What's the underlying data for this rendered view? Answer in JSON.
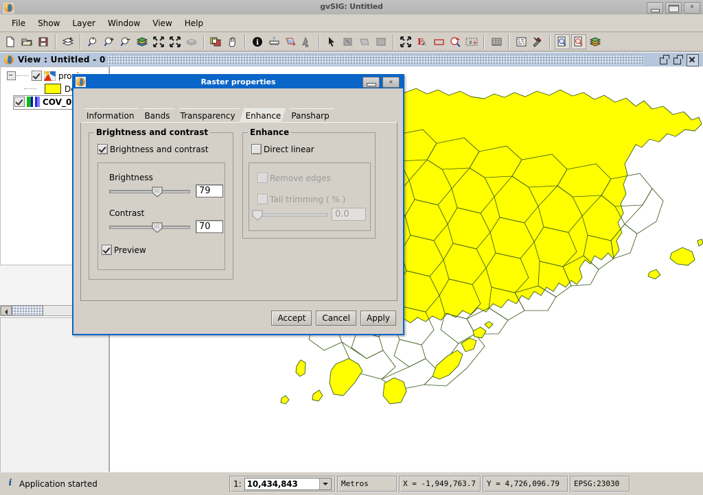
{
  "window": {
    "title": "gvSIG: Untitled",
    "controls": {
      "minimize": "minimize",
      "maximize": "maximize",
      "close": "close"
    }
  },
  "menubar": {
    "items": [
      {
        "label": "File"
      },
      {
        "label": "Show"
      },
      {
        "label": "Layer"
      },
      {
        "label": "Window"
      },
      {
        "label": "View"
      },
      {
        "label": "Help"
      }
    ]
  },
  "toolbar": {
    "groups": [
      [
        "new-document-icon",
        "open-folder-icon",
        "save-icon"
      ],
      [
        "add-layer-icon"
      ],
      [
        "zoom-previous-icon",
        "zoom-in-icon",
        "zoom-out-icon",
        "zoom-layer-icon",
        "zoom-full-icon",
        "zoom-extent-icon",
        "zoom-disabled-icon"
      ],
      [
        "frame-icon",
        "pan-hand-icon"
      ],
      [
        "info-icon",
        "measure-area-icon",
        "select-area-icon",
        "locator-icon"
      ],
      [
        "pointer-icon",
        "select-rect-icon",
        "select-poly-icon",
        "select-all-icon"
      ],
      [
        "zoom-selection-icon",
        "expression-select-icon",
        "rectangle-select-icon",
        "search-select-icon",
        "coordinate-icon"
      ],
      [
        "table-icon"
      ],
      [
        "legend-icon",
        "tools-icon"
      ],
      [
        "print-preview-icon",
        "print-icon",
        "layers-icon"
      ]
    ]
  },
  "view": {
    "title": "View : Untitled - 0",
    "controls": {
      "restore": "restore-window",
      "maximize": "maximize-window",
      "close": "close-window"
    },
    "toc": {
      "layers": [
        {
          "name": "provin...",
          "checked": true,
          "bold": false,
          "expandable": true,
          "swatch": "polygon-layer-icon"
        },
        {
          "name": "De...",
          "checked": null,
          "bold": false,
          "expandable": false,
          "swatch": "yellow-fill-swatch"
        },
        {
          "name": "COV_0...",
          "checked": true,
          "bold": true,
          "expandable": false,
          "swatch": "raster-rgb-icon",
          "selected": true
        }
      ]
    }
  },
  "dialog": {
    "title": "Raster properties",
    "controls": {
      "minimize": "minimize",
      "close": "close"
    },
    "tabs": [
      {
        "label": "Information",
        "active": false
      },
      {
        "label": "Bands",
        "active": false
      },
      {
        "label": "Transparency",
        "active": false
      },
      {
        "label": "Enhance",
        "active": true
      },
      {
        "label": "Pansharp",
        "active": false
      }
    ],
    "brightness_group": {
      "title": "Brightness and contrast",
      "enable_checkbox": {
        "label": "Brightness and contrast",
        "checked": true,
        "enabled": true
      },
      "brightness": {
        "label": "Brightness",
        "value": "79",
        "slider_percent": 58,
        "min": 0,
        "max": 135
      },
      "contrast": {
        "label": "Contrast",
        "value": "70",
        "slider_percent": 55,
        "min": 0,
        "max": 127
      },
      "preview_checkbox": {
        "label": "Preview",
        "checked": true,
        "enabled": true
      }
    },
    "enhance_group": {
      "title": "Enhance",
      "direct_linear": {
        "label": "Direct linear",
        "checked": false,
        "enabled": true
      },
      "remove_edges": {
        "label": "Remove edges",
        "checked": false,
        "enabled": false
      },
      "tail_trimming": {
        "label": "Tail trimming ( % )",
        "checked": false,
        "enabled": false
      },
      "tail_value": {
        "value": "0.0",
        "slider_percent": 2,
        "enabled": false
      }
    },
    "buttons": [
      {
        "label": "Accept"
      },
      {
        "label": "Cancel"
      },
      {
        "label": "Apply"
      }
    ]
  },
  "statusbar": {
    "message": "Application started",
    "scale_label": "1:",
    "scale_value": "10,434,843",
    "units": "Metros",
    "x_coordinate": "X = -1,949,763.7",
    "y_coordinate": "Y = 4,726,096.79",
    "projection": "EPSG:23030"
  },
  "map": {
    "polygon_fill": "#ffff00",
    "polygon_stroke": "#3a5a18",
    "background": "#ffffff"
  }
}
